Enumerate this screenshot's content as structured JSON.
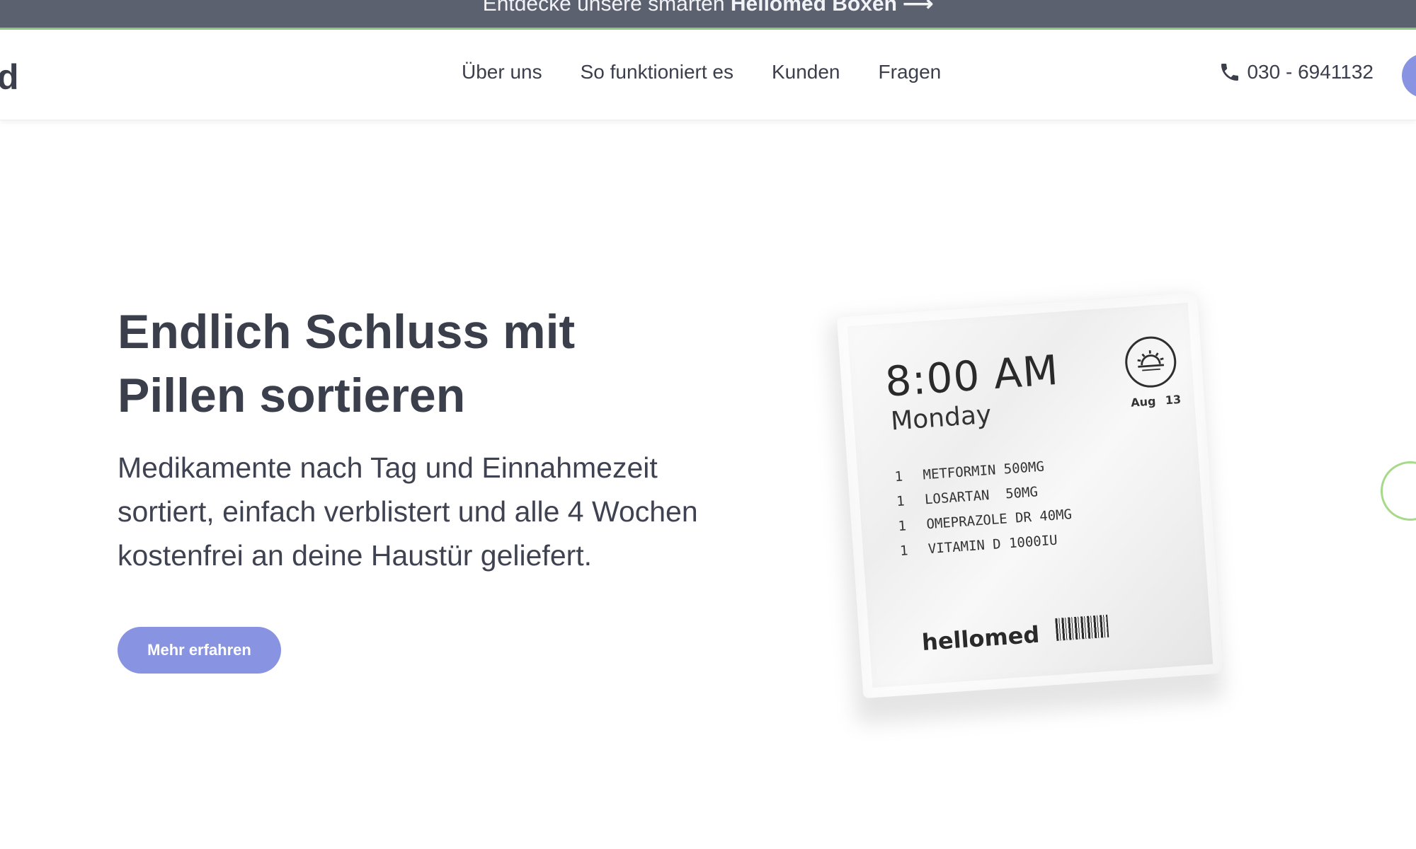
{
  "announcement": {
    "prefix": "Entdecke unsere smarten",
    "bold": "Hellomed Boxen",
    "arrow": "⟶"
  },
  "header": {
    "logo_fragment": "d",
    "nav": [
      {
        "label": "Über uns"
      },
      {
        "label": "So funktioniert es"
      },
      {
        "label": "Kunden"
      },
      {
        "label": "Fragen"
      }
    ],
    "phone": "030 - 6941132"
  },
  "hero": {
    "title_line1": "Endlich Schluss mit",
    "title_line2": "Pillen sortieren",
    "subtitle": "Medikamente nach Tag und Einnahmezeit sortiert, einfach verblistert und alle 4 Wochen kostenfrei an deine Haustür geliefert.",
    "button": "Mehr erfahren"
  },
  "pouch": {
    "time": "8:00 AM",
    "day": "Monday",
    "date": "Aug 13",
    "medications": [
      {
        "qty": "1",
        "name": "METFORMIN 500MG"
      },
      {
        "qty": "1",
        "name": "LOSARTAN  50MG"
      },
      {
        "qty": "1",
        "name": "OMEPRAZOLE DR 40MG"
      },
      {
        "qty": "1",
        "name": "VITAMIN D 1000IU"
      }
    ],
    "brand": "hellomed"
  },
  "colors": {
    "accent": "#8894e2",
    "announcement_bg": "#5c6170",
    "green_accent": "#8cc97a",
    "text_dark": "#3b3e4b"
  }
}
